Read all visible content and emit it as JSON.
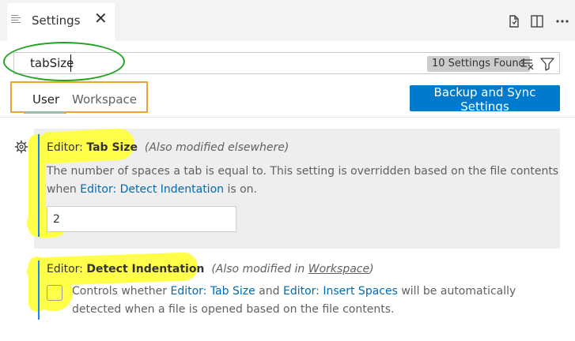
{
  "tab": {
    "title": "Settings",
    "close": "✕"
  },
  "search": {
    "value": "tabSize",
    "results_badge": "10 Settings Found"
  },
  "scope": {
    "user": "User",
    "workspace": "Workspace",
    "sync_button": "Backup and Sync Settings"
  },
  "settings": [
    {
      "category": "Editor: ",
      "name": "Tab Size",
      "note": "(Also modified elsewhere)",
      "desc_line1": "The number of spaces a tab is equal to. This setting is overridden based on the file contents",
      "desc_when": "when ",
      "desc_link": "Editor: Detect Indentation",
      "desc_tail": " is on.",
      "value": "2"
    },
    {
      "category": "Editor: ",
      "name": "Detect Indentation",
      "note_prefix": "(Also modified in ",
      "note_link": "Workspace",
      "note_suffix": ")",
      "desc_prefix": "Controls whether ",
      "desc_link1": "Editor: Tab Size",
      "desc_and": " and ",
      "desc_link2": "Editor: Insert Spaces",
      "desc_suffix": " will be automatically",
      "desc_line2": "detected when a file is opened based on the file contents.",
      "checked": false
    }
  ],
  "icons": {
    "tab": "settings-file-icon",
    "open_json": "open-settings-json-icon",
    "split": "split-editor-icon",
    "clear": "clear-filter-icon",
    "filter": "filter-icon",
    "gear": "gear-icon"
  },
  "colors": {
    "accent": "#007acc",
    "link": "#006ab1",
    "modified_bar": "#1a85ff"
  }
}
